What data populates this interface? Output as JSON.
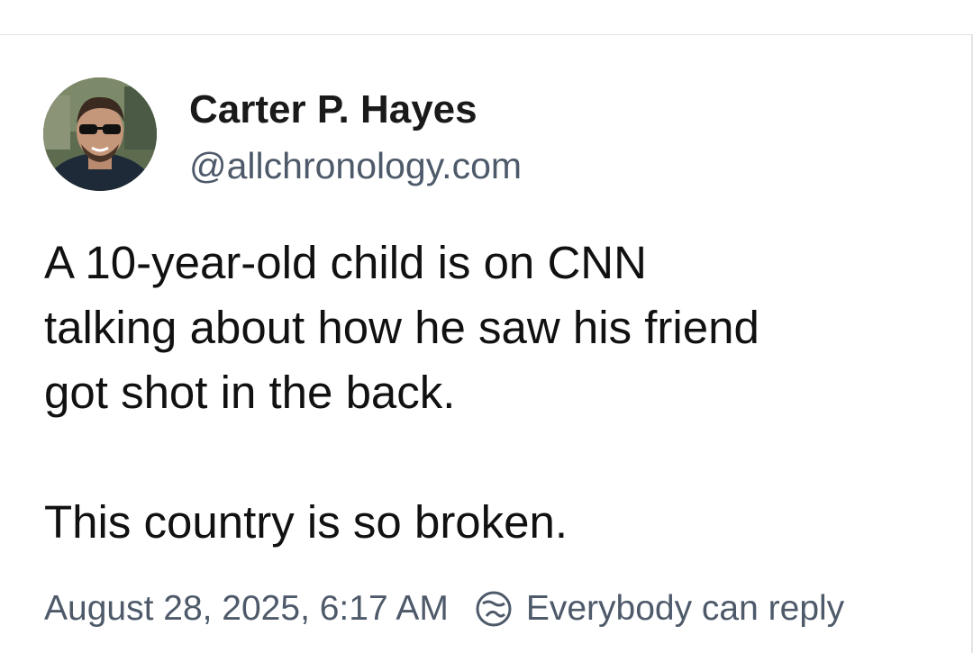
{
  "post": {
    "author": {
      "name": "Carter P. Hayes",
      "handle": "@allchronology.com",
      "avatar_icon": "profile-photo"
    },
    "text_paragraphs": [
      "A 10-year-old child is on CNN\ntalking about how he saw his friend\ngot shot in the back.",
      "This country is so broken."
    ],
    "timestamp": "August 28, 2025, 6:17 AM",
    "reply_setting": {
      "icon": "reply-settings-icon",
      "label": "Everybody can reply"
    }
  },
  "colors": {
    "text_primary": "#111111",
    "text_secondary": "#4e5a6a",
    "border": "#e3e3e3",
    "background": "#ffffff"
  }
}
